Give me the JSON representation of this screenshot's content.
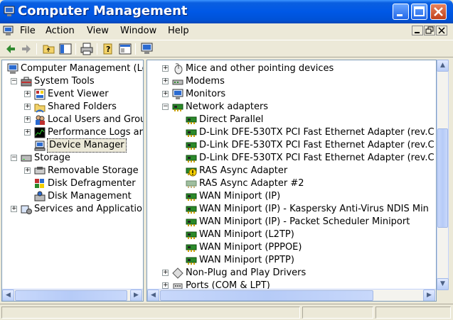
{
  "window": {
    "title": "Computer Management"
  },
  "menu": [
    "File",
    "Action",
    "View",
    "Window",
    "Help"
  ],
  "left_tree": [
    {
      "label": "Computer Management (Lo",
      "level": 0,
      "expander": "",
      "icon": "computer-icon"
    },
    {
      "label": "System Tools",
      "level": 1,
      "expander": "-",
      "icon": "toolbox-icon"
    },
    {
      "label": "Event Viewer",
      "level": 2,
      "expander": "+",
      "icon": "event-viewer-icon"
    },
    {
      "label": "Shared Folders",
      "level": 2,
      "expander": "+",
      "icon": "shared-folder-icon"
    },
    {
      "label": "Local Users and Grou",
      "level": 2,
      "expander": "+",
      "icon": "users-icon"
    },
    {
      "label": "Performance Logs ar",
      "level": 2,
      "expander": "+",
      "icon": "performance-icon"
    },
    {
      "label": "Device Manager",
      "level": 2,
      "expander": "",
      "icon": "device-manager-icon",
      "selected": true
    },
    {
      "label": "Storage",
      "level": 1,
      "expander": "-",
      "icon": "storage-icon"
    },
    {
      "label": "Removable Storage",
      "level": 2,
      "expander": "+",
      "icon": "removable-storage-icon"
    },
    {
      "label": "Disk Defragmenter",
      "level": 2,
      "expander": "",
      "icon": "defrag-icon"
    },
    {
      "label": "Disk Management",
      "level": 2,
      "expander": "",
      "icon": "disk-management-icon"
    },
    {
      "label": "Services and Application",
      "level": 1,
      "expander": "+",
      "icon": "services-icon"
    }
  ],
  "right_tree": [
    {
      "label": "Mice and other pointing devices",
      "level": 0,
      "expander": "+",
      "icon": "mouse-icon"
    },
    {
      "label": "Modems",
      "level": 0,
      "expander": "+",
      "icon": "modem-icon"
    },
    {
      "label": "Monitors",
      "level": 0,
      "expander": "+",
      "icon": "monitor-icon"
    },
    {
      "label": "Network adapters",
      "level": 0,
      "expander": "-",
      "icon": "network-adapter-icon"
    },
    {
      "label": "Direct Parallel",
      "level": 1,
      "expander": "",
      "icon": "network-adapter-icon"
    },
    {
      "label": "D-Link DFE-530TX PCI Fast Ethernet Adapter (rev.C",
      "level": 1,
      "expander": "",
      "icon": "network-adapter-icon"
    },
    {
      "label": "D-Link DFE-530TX PCI Fast Ethernet Adapter (rev.C",
      "level": 1,
      "expander": "",
      "icon": "network-adapter-icon"
    },
    {
      "label": "D-Link DFE-530TX PCI Fast Ethernet Adapter (rev.C",
      "level": 1,
      "expander": "",
      "icon": "network-adapter-icon"
    },
    {
      "label": "RAS Async Adapter",
      "level": 1,
      "expander": "",
      "icon": "network-adapter-warning-icon"
    },
    {
      "label": "RAS Async Adapter #2",
      "level": 1,
      "expander": "",
      "icon": "network-adapter-disabled-icon"
    },
    {
      "label": "WAN Miniport (IP)",
      "level": 1,
      "expander": "",
      "icon": "network-adapter-icon"
    },
    {
      "label": "WAN Miniport (IP) - Kaspersky Anti-Virus NDIS Min",
      "level": 1,
      "expander": "",
      "icon": "network-adapter-icon"
    },
    {
      "label": "WAN Miniport (IP) - Packet Scheduler Miniport",
      "level": 1,
      "expander": "",
      "icon": "network-adapter-icon"
    },
    {
      "label": "WAN Miniport (L2TP)",
      "level": 1,
      "expander": "",
      "icon": "network-adapter-icon"
    },
    {
      "label": "WAN Miniport (PPPOE)",
      "level": 1,
      "expander": "",
      "icon": "network-adapter-icon"
    },
    {
      "label": "WAN Miniport (PPTP)",
      "level": 1,
      "expander": "",
      "icon": "network-adapter-icon"
    },
    {
      "label": "Non-Plug and Play Drivers",
      "level": 0,
      "expander": "+",
      "icon": "driver-icon"
    },
    {
      "label": "Ports (COM & LPT)",
      "level": 0,
      "expander": "+",
      "icon": "port-icon"
    }
  ],
  "colors": {
    "title_bar": "#0058e6",
    "adapter_green": "#2a8a2a",
    "warning_yellow": "#f5d000"
  }
}
